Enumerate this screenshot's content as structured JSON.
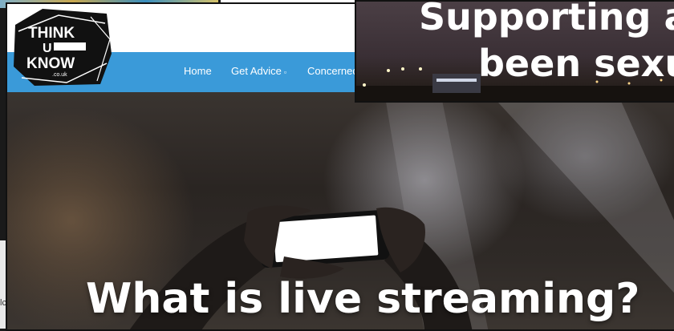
{
  "logo": {
    "line1": "THINK",
    "line2": "U",
    "line3": "KNOW",
    "sub": ".co.uk"
  },
  "nav": {
    "items": [
      {
        "label": "Home"
      },
      {
        "label": "Get Advice",
        "caret": "▫"
      },
      {
        "label": "Concerned"
      }
    ]
  },
  "hero": {
    "title": "What is live streaming?"
  },
  "overlay": {
    "line1": "Supporting a",
    "line2": "been sexu"
  },
  "background": {
    "left_fragment": "lc"
  },
  "colors": {
    "nav_bg": "#3a9ad9",
    "header_bg": "#ffffff",
    "title": "#ffffff"
  }
}
